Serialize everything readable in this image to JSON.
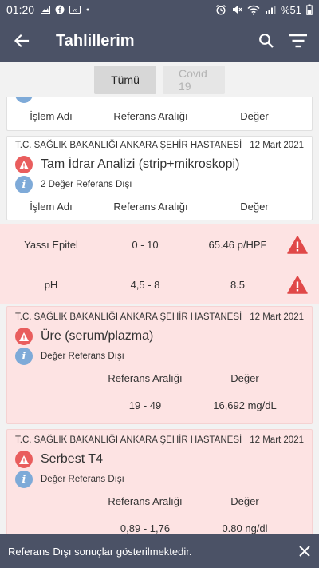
{
  "statusbar": {
    "time": "01:20",
    "battery": "%51"
  },
  "appbar": {
    "title": "Tahlillerim"
  },
  "tabs": [
    {
      "label": "Tümü"
    },
    {
      "label": "Covid 19"
    }
  ],
  "columns": {
    "name": "İşlem Adı",
    "range": "Referans Aralığı",
    "value": "Değer"
  },
  "cards": [
    {
      "hospital": "T.C. SAĞLIK BAKANLIĞI ANKARA ŞEHİR HASTANESİ",
      "date": "12 Mart 2021",
      "test": "Tam İdrar Analizi (strip+mikroskopi)",
      "info": "2 Değer Referans Dışı",
      "results": [
        {
          "name": "Yassı Epitel",
          "range": "0 - 10",
          "value": "65.46 p/HPF"
        },
        {
          "name": "pH",
          "range": "4,5 - 8",
          "value": "8.5"
        }
      ]
    },
    {
      "hospital": "T.C. SAĞLIK BAKANLIĞI ANKARA ŞEHİR HASTANESİ",
      "date": "12 Mart 2021",
      "test": "Üre (serum/plazma)",
      "info": "Değer Referans Dışı",
      "range": "19 - 49",
      "value": "16,692 mg/dL"
    },
    {
      "hospital": "T.C. SAĞLIK BAKANLIĞI ANKARA ŞEHİR HASTANESİ",
      "date": "12 Mart 2021",
      "test": "Serbest T4",
      "info": "Değer Referans Dışı",
      "range": "0,89 - 1,76",
      "value": "0.80 ng/dl"
    }
  ],
  "snackbar": {
    "message": "Referans Dışı sonuçlar gösterilmektedir."
  }
}
